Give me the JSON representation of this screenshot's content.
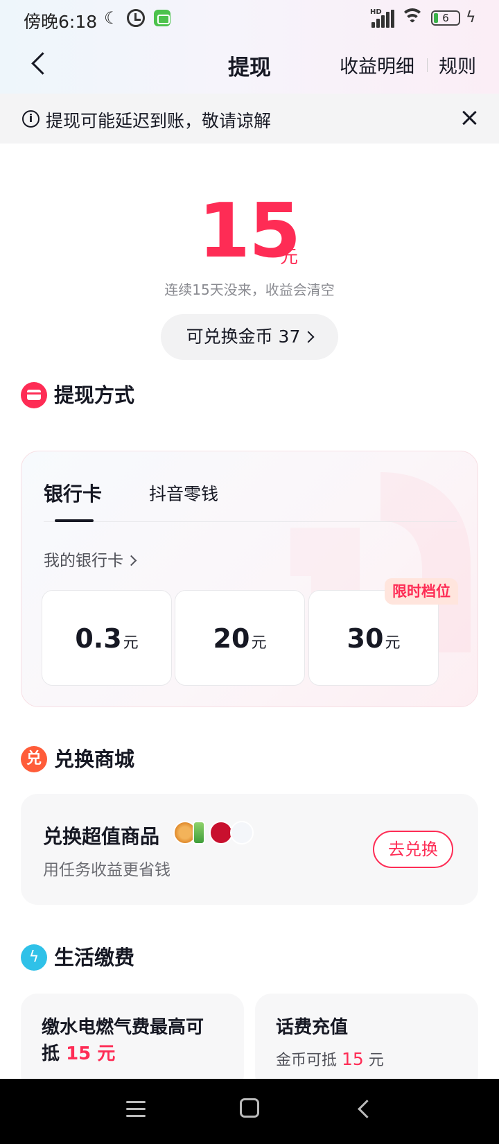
{
  "status_bar": {
    "time": "傍晚6:18",
    "battery": "6"
  },
  "nav": {
    "title": "提现",
    "earnings_detail": "收益明细",
    "rules": "规则"
  },
  "notice": {
    "text": "提现可能延迟到账，敬请谅解"
  },
  "balance": {
    "amount": "15",
    "unit": "元",
    "warning": "连续15天没来，收益会清空",
    "coins_label": "可兑换金币 37"
  },
  "withdraw_section": {
    "title": "提现方式",
    "tabs": [
      {
        "label": "银行卡",
        "active": true
      },
      {
        "label": "抖音零钱",
        "active": false
      }
    ],
    "my_card_link": "我的银行卡",
    "options": [
      {
        "value": "0.3",
        "unit": "元"
      },
      {
        "value": "20",
        "unit": "元"
      },
      {
        "value": "30",
        "unit": "元"
      }
    ],
    "limited_badge": "限时档位"
  },
  "exchange_section": {
    "title": "兑换商城",
    "card_title": "兑换超值商品",
    "card_subtitle": "用任务收益更省钱",
    "button": "去兑换"
  },
  "life_section": {
    "title": "生活缴费",
    "utilities": {
      "title_prefix": "缴水电燃气费最高可",
      "title_line2": "抵",
      "amount": "15",
      "unit": "元"
    },
    "phone": {
      "title": "话费充值",
      "sub_prefix": "金币可抵",
      "amount": "15",
      "unit": "元"
    }
  },
  "colors": {
    "accent": "#fe2c55",
    "text": "#161823",
    "muted": "#8a8b91"
  }
}
